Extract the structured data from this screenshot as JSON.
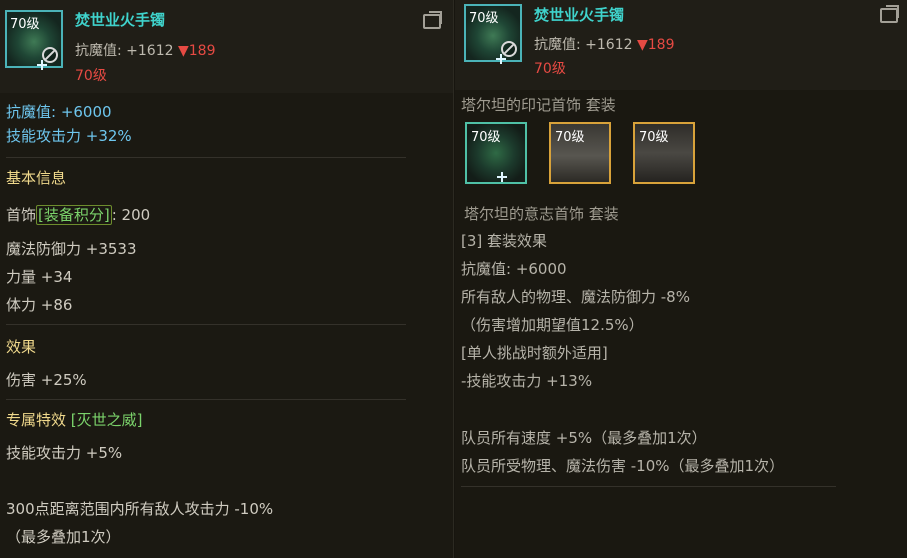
{
  "left": {
    "item": {
      "level_badge": "70级",
      "name": "焚世业火手镯",
      "stat_label": "抗魔值: +1612",
      "stat_down": "▼189",
      "level": "70级",
      "icon": "bracelet-icon"
    },
    "stats": [
      "抗魔值: +6000",
      "技能攻击力 +32%"
    ],
    "basic_title": "基本信息",
    "slot": "首饰",
    "score_label": "[装备积分]",
    "score_value": ": 200",
    "attrs": [
      "魔法防御力 +3533",
      "力量 +34",
      "体力 +86"
    ],
    "effect_title": "效果",
    "effect": "伤害 +25%",
    "special_title": "专属特效",
    "special_name": "[灭世之威]",
    "special_effect": "技能攻击力 +5%",
    "extra_line1": "300点距离范围内所有敌人攻击力 -10%",
    "extra_line2": "（最多叠加1次）"
  },
  "right": {
    "item": {
      "level_badge": "70级",
      "name": "焚世业火手镯",
      "stat_label": "抗魔值: +1612",
      "stat_down": "▼189",
      "level": "70级"
    },
    "set1_title": "塔尔坦的印记首饰  套装",
    "set_items": [
      {
        "level": "70级",
        "icon": "bracelet-icon"
      },
      {
        "level": "70级",
        "icon": "ring-icon"
      },
      {
        "level": "70级",
        "icon": "necklace-icon"
      }
    ],
    "set2_title": "塔尔坦的意志首饰  套装",
    "set_effect_title": "[3] 套装效果",
    "set_lines": [
      "抗魔值: +6000",
      "所有敌人的物理、魔法防御力 -8%",
      "（伤害增加期望值12.5%）",
      "[单人挑战时额外适用]",
      "-技能攻击力 +13%",
      "",
      "队员所有速度 +5%（最多叠加1次）",
      "队员所受物理、魔法伤害 -10%（最多叠加1次）"
    ]
  },
  "colors": {
    "name": "#3fd3cc",
    "blue_stat": "#6ec6ee",
    "section_head": "#f0d98c",
    "green": "#7bd36b",
    "red": "#e64a43"
  }
}
